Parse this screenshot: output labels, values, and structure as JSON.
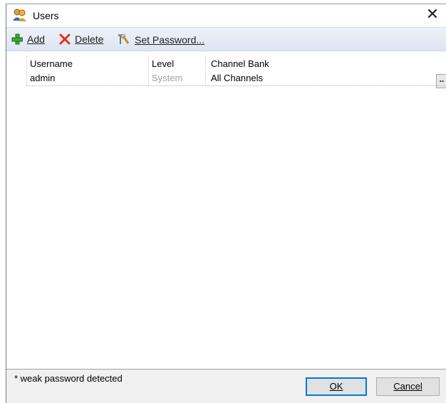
{
  "window": {
    "title": "Users",
    "icon": "users-icon",
    "close_glyph": "✕"
  },
  "toolbar": {
    "add_label": "Add",
    "delete_label": "Delete",
    "set_password_label": "Set Password..."
  },
  "grid": {
    "columns": [
      "Username",
      "Level",
      "Channel Bank"
    ],
    "rows": [
      {
        "username": "admin",
        "level": "System",
        "channel_bank": "All Channels",
        "button": ".."
      }
    ]
  },
  "footer": {
    "note": "* weak password detected",
    "ok_label": "OK",
    "cancel_label": "Cancel"
  },
  "colors": {
    "accent": "#0078d7",
    "level_text": "#a0a0a0",
    "toolbar_bg": "#dde5f1"
  }
}
